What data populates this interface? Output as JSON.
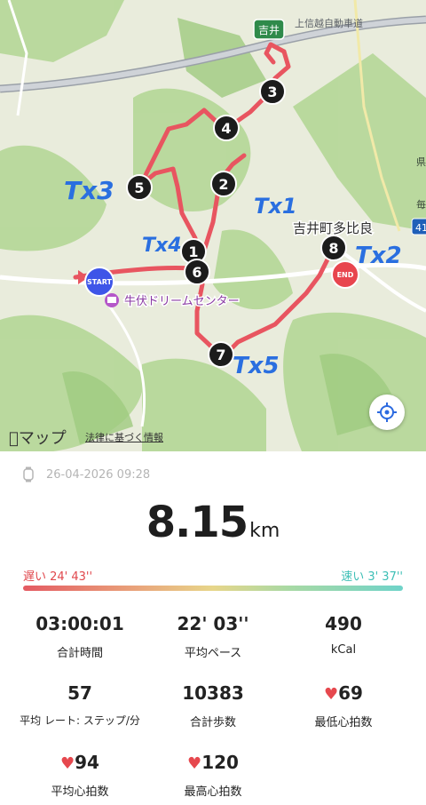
{
  "map": {
    "labels": {
      "yoshii": "吉井",
      "expressway": "上信越自動車道",
      "town": "吉井町多比良",
      "facility": "牛伏ドリームセンター",
      "route_num": "41",
      "side_ken": "県",
      "side_second": "毎"
    },
    "markers": [
      "1",
      "2",
      "3",
      "4",
      "5",
      "6",
      "7",
      "8"
    ],
    "start_label": "START",
    "end_label": "END",
    "handwritten": [
      "Tx1",
      "Tx2",
      "Tx3",
      "Tx4",
      "Tx5"
    ],
    "brand": "マップ",
    "legal": "法律に基づく情報",
    "route_color": "#e85560"
  },
  "workout": {
    "datetime": "26-04-2026 09:28",
    "distance": "8.15",
    "distance_unit": "km",
    "pace_slow": "遅い 24' 43''",
    "pace_fast": "速い 3' 37''",
    "stats": [
      {
        "value": "03:00:01",
        "label": "合計時間"
      },
      {
        "value": "22' 03''",
        "label": "平均ペース"
      },
      {
        "value": "490",
        "label": "kCal"
      },
      {
        "value": "57",
        "label": "平均 レート: ステップ/分"
      },
      {
        "value": "10383",
        "label": "合計歩数"
      },
      {
        "value": "69",
        "label": "最低心拍数"
      },
      {
        "value": "94",
        "label": "平均心拍数"
      },
      {
        "value": "120",
        "label": "最高心拍数"
      }
    ]
  }
}
